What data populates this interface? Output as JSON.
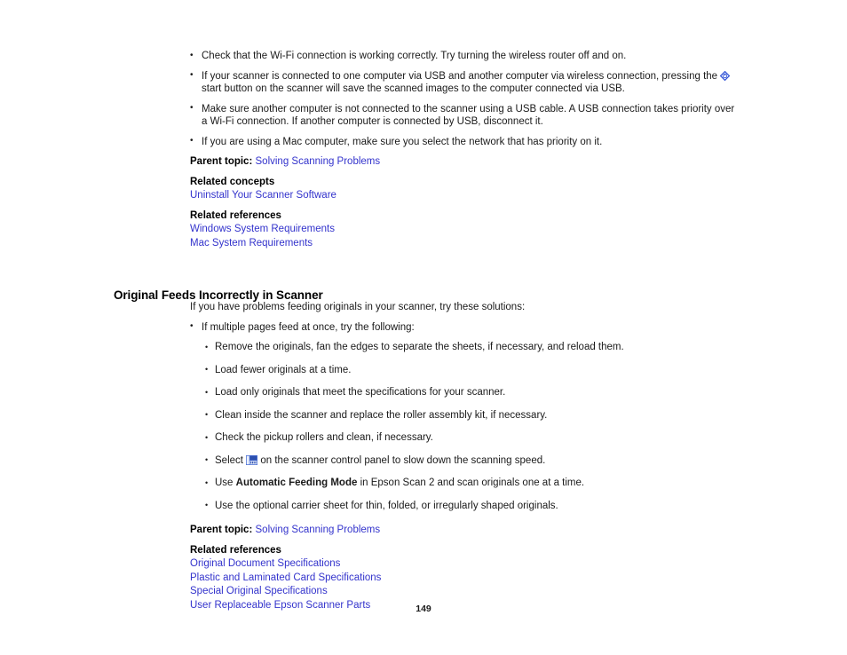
{
  "page": {
    "number": "149",
    "link_color": "#3333CC",
    "text_color": "#1A1A1A"
  },
  "section_top": {
    "bullets": [
      "Check that the Wi-Fi connection is working correctly. Try turning the wireless router off and on.",
      "If your scanner is connected to one computer via USB and another computer via wireless connection, pressing the ",
      "Make sure another computer is not connected to the scanner using a USB cable. A USB connection takes priority over a Wi-Fi connection. If another computer is connected by USB, disconnect it.",
      "If you are using a Mac computer, make sure you select the network that has priority on it."
    ],
    "bullet2_after_icon": " start button on the scanner will save the scanned images to the computer connected via USB.",
    "start_icon_name": "start-button-icon",
    "parent_topic_label": "Parent topic:",
    "parent_topic_link": "Solving Scanning Problems",
    "related_concepts_label": "Related concepts",
    "related_concepts_links": [
      "Uninstall Your Scanner Software"
    ],
    "related_references_label": "Related references",
    "related_references_links": [
      "Windows System Requirements",
      "Mac System Requirements"
    ]
  },
  "section_main": {
    "heading": "Original Feeds Incorrectly in Scanner",
    "intro": "If you have problems feeding originals in your scanner, try these solutions:",
    "bullet_lead": "If multiple pages feed at once, try the following:",
    "sub_bullets": [
      "Remove the originals, fan the edges to separate the sheets, if necessary, and reload them.",
      "Load fewer originals at a time.",
      "Load only originals that meet the specifications for your scanner.",
      "Clean inside the scanner and replace the roller assembly kit, if necessary.",
      "Check the pickup rollers and clean, if necessary.",
      "Use the optional carrier sheet for thin, folded, or irregularly shaped originals."
    ],
    "slow_mode": {
      "before": "Select ",
      "icon_name": "slow-mode-icon",
      "after": " on the scanner control panel to slow down the scanning speed."
    },
    "auto_feed": {
      "before": "Use ",
      "bold": "Automatic Feeding Mode",
      "after": " in Epson Scan 2 and scan originals one at a time."
    },
    "parent_topic_label": "Parent topic:",
    "parent_topic_link": "Solving Scanning Problems",
    "related_references_label": "Related references",
    "related_references_links": [
      "Original Document Specifications",
      "Plastic and Laminated Card Specifications",
      "Special Original Specifications",
      "User Replaceable Epson Scanner Parts"
    ]
  }
}
